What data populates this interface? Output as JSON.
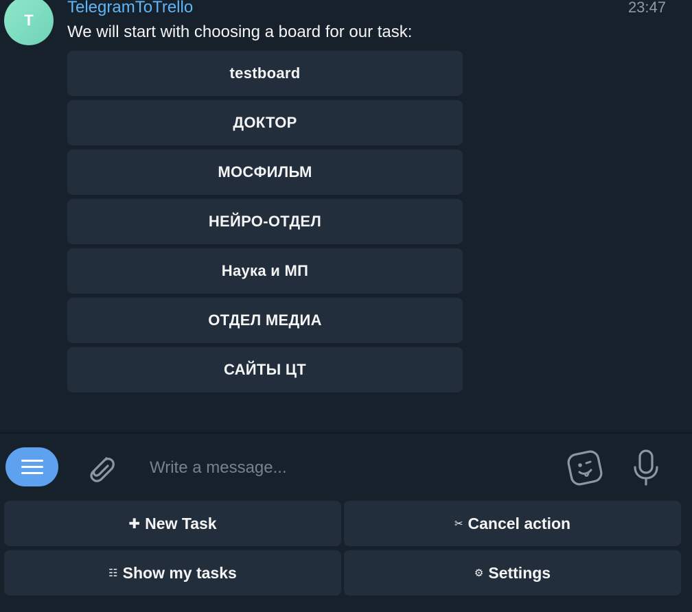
{
  "chat": {
    "avatar_letter": "T",
    "sender": "TelegramToTrello",
    "time": "23:47",
    "message": "We will start with choosing a board for our task:",
    "inline_buttons": [
      "testboard",
      "ДОКТОР",
      "МОСФИЛЬМ",
      "НЕЙРО-ОТДЕЛ",
      "Наука и МП",
      "ОТДЕЛ МЕДИА",
      "САЙТЫ ЦТ"
    ]
  },
  "composer": {
    "placeholder": "Write a message...",
    "icons": {
      "menu": "menu-icon",
      "attach": "paperclip-icon",
      "sticker": "sticker-icon",
      "mic": "microphone-icon"
    }
  },
  "reply_keyboard": {
    "new_task": {
      "icon": "✚",
      "label": "New Task"
    },
    "cancel": {
      "icon": "✂",
      "label": "Cancel action"
    },
    "show_tasks": {
      "icon": "☷",
      "label": "Show my tasks"
    },
    "settings": {
      "icon": "⚙",
      "label": "Settings"
    }
  },
  "colors": {
    "background": "#17212b",
    "button": "#232e3c",
    "accent": "#5ea2ef",
    "sender": "#5eb5f7"
  }
}
